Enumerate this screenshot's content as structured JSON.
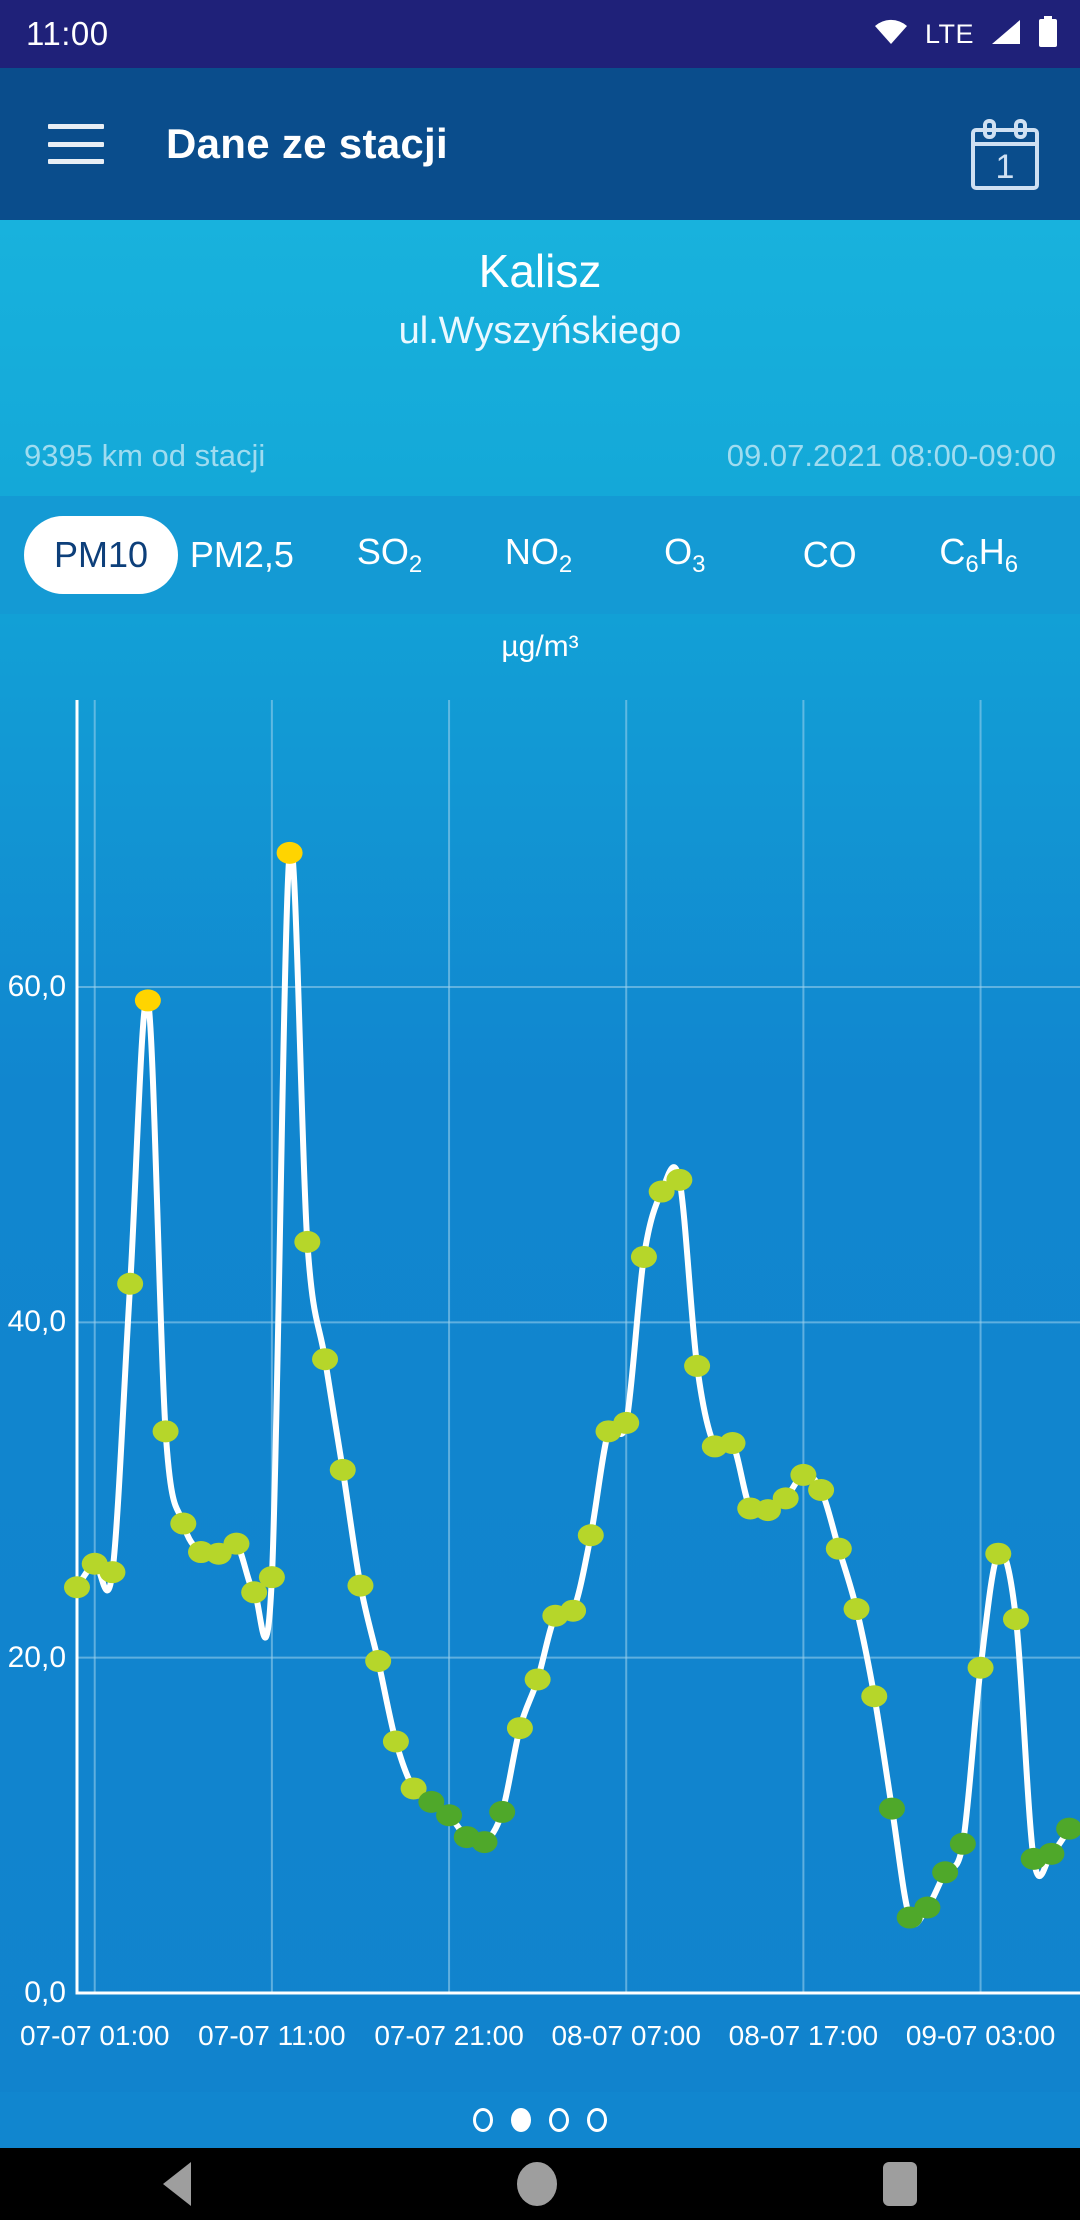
{
  "status_bar": {
    "time": "11:00",
    "network_label": "LTE",
    "icons": [
      "wifi-icon",
      "signal-icon",
      "battery-icon"
    ]
  },
  "app_bar": {
    "menu_icon": "hamburger-menu-icon",
    "title": "Dane ze stacji",
    "calendar_icon": "calendar-icon",
    "calendar_day": "1"
  },
  "station": {
    "name": "Kalisz",
    "street": "ul.Wyszyńskiego",
    "distance": "9395 km od stacji",
    "datetime_range": "09.07.2021 08:00-09:00"
  },
  "tabs": [
    {
      "label": "PM10",
      "active": true
    },
    {
      "label": "PM2,5",
      "active": false
    },
    {
      "label": "SO",
      "sub": "2",
      "active": false
    },
    {
      "label": "NO",
      "sub": "2",
      "active": false
    },
    {
      "label": "O",
      "sub": "3",
      "active": false
    },
    {
      "label": "CO",
      "active": false
    },
    {
      "label": "C",
      "sub": "6",
      "label2": "H",
      "sub2": "6",
      "active": false
    }
  ],
  "pager": {
    "count": 4,
    "active_index": 1
  },
  "nav_bar": {
    "back": "back-triangle-icon",
    "home": "home-circle-icon",
    "recents": "recents-square-icon"
  },
  "colors": {
    "status_bar": "#1f2179",
    "app_bar": "#0a4d8c",
    "station_header": "#14a8d8",
    "tabs_bg": "#149ad4",
    "chart_bg_top": "#12a0d6",
    "chart_bg_bottom": "#1183cd",
    "line": "#ffffff",
    "marker_low": "#4fa82a",
    "marker_mid": "#b6d62a",
    "marker_high": "#ffd400",
    "tab_active_text": "#0d3f7a"
  },
  "chart_data": {
    "type": "line",
    "title": "",
    "ylabel": "µg/m³",
    "xlabel": "",
    "ylim": [
      0,
      80
    ],
    "grid": true,
    "y_ticks": [
      "0,0",
      "20,0",
      "40,0",
      "60,0"
    ],
    "y_tick_values": [
      0,
      20,
      40,
      60
    ],
    "x_ticks": [
      "07-07 01:00",
      "07-07 11:00",
      "07-07 21:00",
      "08-07 07:00",
      "08-07 17:00",
      "09-07 03:00"
    ],
    "x_tick_hours": [
      1,
      11,
      21,
      31,
      41,
      51
    ],
    "legend": [],
    "series": [
      {
        "name": "PM10",
        "unit": "µg/m³",
        "x": [
          0,
          1,
          2,
          3,
          4,
          5,
          6,
          7,
          8,
          9,
          10,
          11,
          12,
          13,
          14,
          15,
          16,
          17,
          18,
          19,
          20,
          21,
          22,
          23,
          24,
          25,
          26,
          27,
          28,
          29,
          30,
          31,
          32,
          33,
          34,
          35,
          36,
          37,
          38,
          39,
          40,
          41,
          42,
          43,
          44,
          45,
          46,
          47,
          48,
          49,
          50,
          51,
          52,
          53,
          54,
          55,
          56
        ],
        "x_labels": [
          "07-07 00:00",
          "07-07 01:00",
          "07-07 02:00",
          "07-07 03:00",
          "07-07 04:00",
          "07-07 05:00",
          "07-07 06:00",
          "07-07 07:00",
          "07-07 08:00",
          "07-07 09:00",
          "07-07 10:00",
          "07-07 11:00",
          "07-07 12:00",
          "07-07 13:00",
          "07-07 14:00",
          "07-07 15:00",
          "07-07 16:00",
          "07-07 17:00",
          "07-07 18:00",
          "07-07 19:00",
          "07-07 20:00",
          "07-07 21:00",
          "07-07 22:00",
          "07-07 23:00",
          "08-07 00:00",
          "08-07 01:00",
          "08-07 02:00",
          "08-07 03:00",
          "08-07 04:00",
          "08-07 05:00",
          "08-07 06:00",
          "08-07 07:00",
          "08-07 08:00",
          "08-07 09:00",
          "08-07 10:00",
          "08-07 11:00",
          "08-07 12:00",
          "08-07 13:00",
          "08-07 14:00",
          "08-07 15:00",
          "08-07 16:00",
          "08-07 17:00",
          "08-07 18:00",
          "08-07 19:00",
          "08-07 20:00",
          "08-07 21:00",
          "08-07 22:00",
          "08-07 23:00",
          "09-07 00:00",
          "09-07 01:00",
          "09-07 02:00",
          "09-07 03:00",
          "09-07 04:00",
          "09-07 05:00",
          "09-07 06:00",
          "09-07 07:00",
          "09-07 08:00"
        ],
        "values": [
          24.2,
          25.6,
          25.1,
          42.3,
          59.2,
          33.5,
          28.0,
          26.3,
          26.2,
          26.8,
          23.9,
          24.8,
          68.0,
          44.8,
          37.8,
          31.2,
          24.3,
          19.8,
          15.0,
          12.2,
          11.4,
          10.6,
          9.3,
          9.0,
          10.8,
          15.8,
          18.7,
          22.5,
          22.8,
          27.3,
          33.5,
          34.0,
          43.9,
          47.8,
          48.5,
          37.4,
          32.6,
          32.8,
          28.9,
          28.8,
          29.5,
          30.9,
          30.0,
          26.5,
          22.9,
          17.7,
          11.0,
          4.5,
          5.1,
          7.2,
          8.9,
          19.4,
          26.2,
          22.3,
          8.0,
          8.3,
          9.8
        ]
      }
    ]
  }
}
